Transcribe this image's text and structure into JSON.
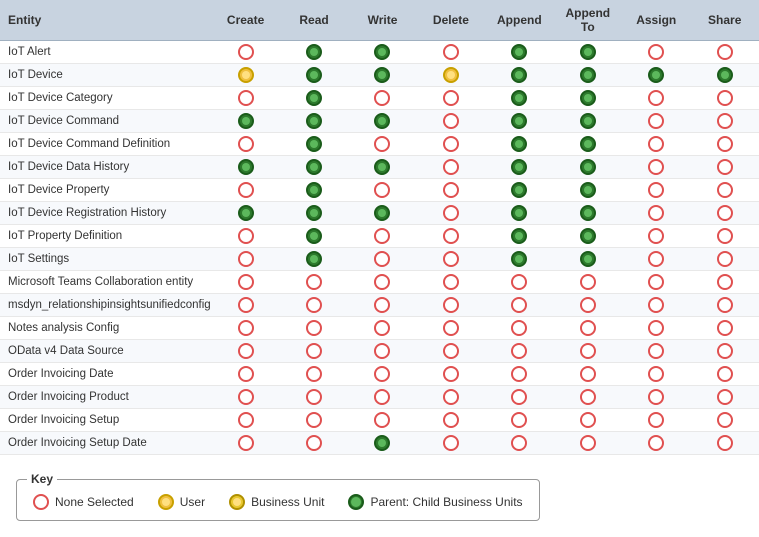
{
  "header": {
    "columns": [
      "Entity",
      "Create",
      "Read",
      "Write",
      "Delete",
      "Append",
      "Append To",
      "Assign",
      "Share"
    ]
  },
  "rows": [
    {
      "entity": "IoT Alert",
      "perms": [
        "none",
        "green",
        "green",
        "none",
        "green",
        "green",
        "none",
        "none"
      ]
    },
    {
      "entity": "IoT Device",
      "perms": [
        "yellow",
        "green",
        "green",
        "yellow",
        "green",
        "green",
        "green",
        "green"
      ]
    },
    {
      "entity": "IoT Device Category",
      "perms": [
        "none",
        "green",
        "none",
        "none",
        "green",
        "green",
        "none",
        "none"
      ]
    },
    {
      "entity": "IoT Device Command",
      "perms": [
        "green",
        "green",
        "green",
        "none",
        "green",
        "green",
        "none",
        "none"
      ]
    },
    {
      "entity": "IoT Device Command Definition",
      "perms": [
        "none",
        "green",
        "none",
        "none",
        "green",
        "green",
        "none",
        "none"
      ]
    },
    {
      "entity": "IoT Device Data History",
      "perms": [
        "green",
        "green",
        "green",
        "none",
        "green",
        "green",
        "none",
        "none"
      ]
    },
    {
      "entity": "IoT Device Property",
      "perms": [
        "none",
        "green",
        "none",
        "none",
        "green",
        "green",
        "none",
        "none"
      ]
    },
    {
      "entity": "IoT Device Registration History",
      "perms": [
        "green",
        "green",
        "green",
        "none",
        "green",
        "green",
        "none",
        "none"
      ]
    },
    {
      "entity": "IoT Property Definition",
      "perms": [
        "none",
        "green",
        "none",
        "none",
        "green",
        "green",
        "none",
        "none"
      ]
    },
    {
      "entity": "IoT Settings",
      "perms": [
        "none",
        "green",
        "none",
        "none",
        "green",
        "green",
        "none",
        "none"
      ]
    },
    {
      "entity": "Microsoft Teams Collaboration entity",
      "perms": [
        "none",
        "none",
        "none",
        "none",
        "none",
        "none",
        "none",
        "none"
      ]
    },
    {
      "entity": "msdyn_relationshipinsightsunifiedconfig",
      "perms": [
        "none",
        "none",
        "none",
        "none",
        "none",
        "none",
        "none",
        "none"
      ]
    },
    {
      "entity": "Notes analysis Config",
      "perms": [
        "none",
        "none",
        "none",
        "none",
        "none",
        "none",
        "none",
        "none"
      ]
    },
    {
      "entity": "OData v4 Data Source",
      "perms": [
        "none",
        "none",
        "none",
        "none",
        "none",
        "none",
        "none",
        "none"
      ]
    },
    {
      "entity": "Order Invoicing Date",
      "perms": [
        "none",
        "none",
        "none",
        "none",
        "none",
        "none",
        "none",
        "none"
      ]
    },
    {
      "entity": "Order Invoicing Product",
      "perms": [
        "none",
        "none",
        "none",
        "none",
        "none",
        "none",
        "none",
        "none"
      ]
    },
    {
      "entity": "Order Invoicing Setup",
      "perms": [
        "none",
        "none",
        "none",
        "none",
        "none",
        "none",
        "none",
        "none"
      ]
    },
    {
      "entity": "Order Invoicing Setup Date",
      "perms": [
        "none",
        "none",
        "green",
        "none",
        "none",
        "none",
        "none",
        "none"
      ]
    }
  ],
  "key": {
    "title": "Key",
    "items": [
      {
        "type": "none",
        "label": "None Selected"
      },
      {
        "type": "yellow",
        "label": "User"
      },
      {
        "type": "bu",
        "label": "Business Unit"
      },
      {
        "type": "green",
        "label": "Parent: Child Business Units"
      }
    ]
  }
}
